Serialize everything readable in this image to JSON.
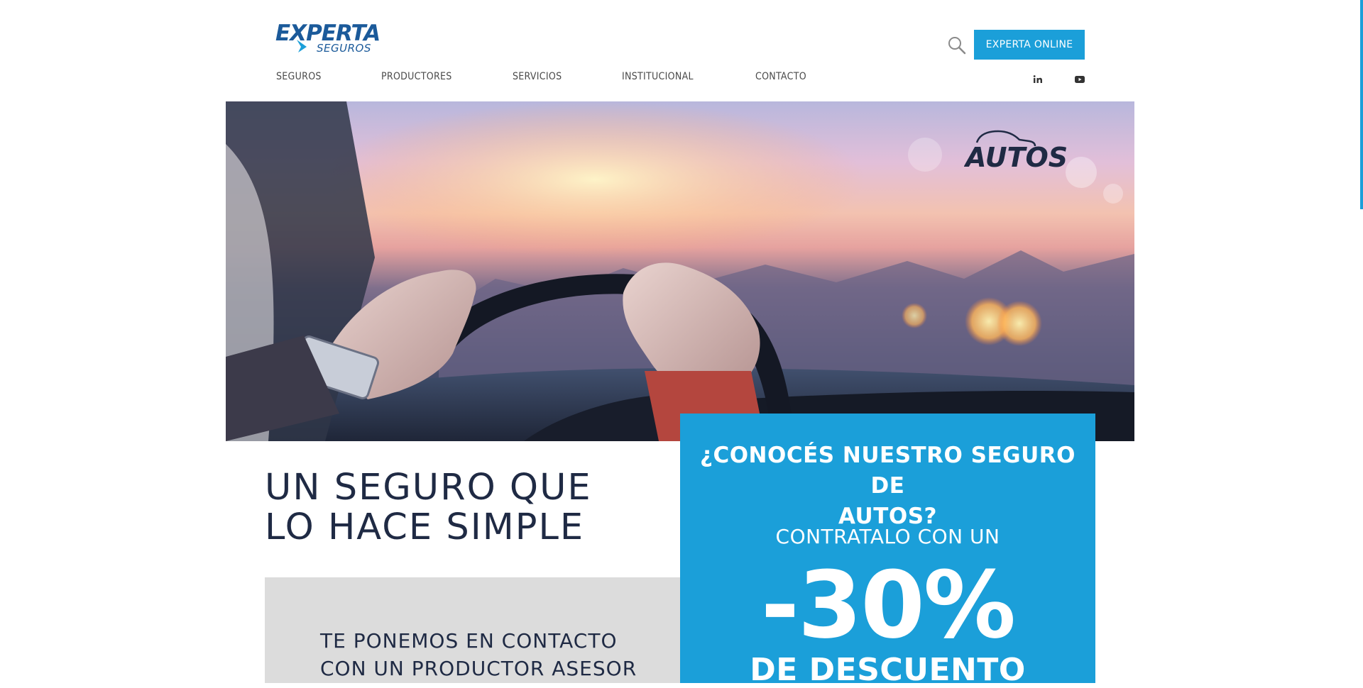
{
  "brand": {
    "logo_main": "EXPERTA",
    "logo_sub": "SEGUROS",
    "color_primary": "#1b9fd9",
    "color_dark": "#1f2a44",
    "color_logo": "#1b5a9a"
  },
  "header": {
    "search_icon": "search-icon",
    "online_button": "EXPERTA ONLINE"
  },
  "nav": {
    "items": [
      "SEGUROS",
      "PRODUCTORES",
      "SERVICIOS",
      "INSTITUCIONAL",
      "CONTACTO"
    ]
  },
  "social": {
    "linkedin": "linkedin-icon",
    "youtube": "youtube-icon"
  },
  "hero": {
    "badge": "AUTOS",
    "image": "hands-on-steering-wheel-sunset"
  },
  "main": {
    "headline_line1": "UN SEGURO QUE",
    "headline_line2": "LO HACE SIMPLE",
    "contact_line1": "TE PONEMOS EN CONTACTO",
    "contact_line2": "CON UN PRODUCTOR ASESOR"
  },
  "promo": {
    "question_line1": "¿CONOCÉS NUESTRO SEGURO DE",
    "question_line2": "AUTOS?",
    "subtitle": "CONTRATALO CON UN",
    "percent": "-30%",
    "discount": "DE DESCUENTO"
  }
}
